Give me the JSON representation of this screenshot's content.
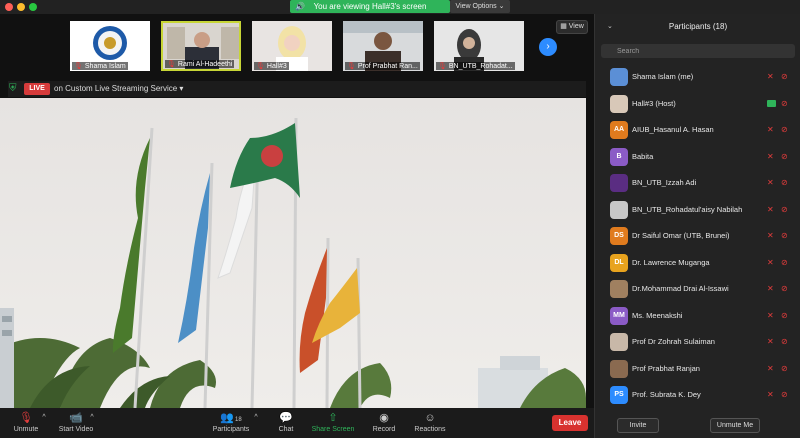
{
  "banner": {
    "viewing_text": "You are viewing Hall#3's screen",
    "view_options_label": "View Options ⌄"
  },
  "thumbnails": [
    {
      "name": "Shama Islam"
    },
    {
      "name": "Rami Al-Hadeethi"
    },
    {
      "name": "Hall#3"
    },
    {
      "name": "Prof Prabhat Ran..."
    },
    {
      "name": "BN_UTB_Rohadat..."
    }
  ],
  "view_button_label": "View",
  "live": {
    "badge": "LIVE",
    "text": "on Custom Live Streaming Service ▾"
  },
  "toolbar": {
    "unmute": "Unmute",
    "start_video": "Start Video",
    "participants": "Participants",
    "participants_count": "18",
    "chat": "Chat",
    "share_screen": "Share Screen",
    "record": "Record",
    "reactions": "Reactions",
    "leave": "Leave"
  },
  "panel": {
    "title": "Participants (18)",
    "search_placeholder": "Search",
    "invite": "Invite",
    "unmute_me": "Unmute Me",
    "participants": [
      {
        "name": "Shama Islam (me)",
        "initials": "",
        "color": "#5b8fd6",
        "status": "muted"
      },
      {
        "name": "Hall#3 (Host)",
        "initials": "",
        "color": "#d8c8b8",
        "status": "sharing"
      },
      {
        "name": "AIUB_Hasanul A. Hasan",
        "initials": "AA",
        "color": "#e07b1e",
        "status": "muted"
      },
      {
        "name": "Babita",
        "initials": "B",
        "color": "#8b5bc6",
        "status": "muted"
      },
      {
        "name": "BN_UTB_Izzah Adi",
        "initials": "",
        "color": "#5a2d82",
        "status": "muted"
      },
      {
        "name": "BN_UTB_Rohadatul'aisy Nabilah",
        "initials": "",
        "color": "#c8c8c8",
        "status": "muted"
      },
      {
        "name": "Dr Saiful Omar (UTB, Brunei)",
        "initials": "DS",
        "color": "#e07b1e",
        "status": "muted"
      },
      {
        "name": "Dr. Lawrence Muganga",
        "initials": "DL",
        "color": "#e8a31e",
        "status": "muted"
      },
      {
        "name": "Dr.Mohammad Drai Al-Issawi",
        "initials": "",
        "color": "#a08060",
        "status": "muted"
      },
      {
        "name": "Ms. Meenakshi",
        "initials": "MM",
        "color": "#8b5bc6",
        "status": "muted"
      },
      {
        "name": "Prof Dr Zohrah Sulaiman",
        "initials": "",
        "color": "#c8b8a8",
        "status": "muted"
      },
      {
        "name": "Prof Prabhat Ranjan",
        "initials": "",
        "color": "#8a6a50",
        "status": "muted"
      },
      {
        "name": "Prof. Subrata K. Dey",
        "initials": "PS",
        "color": "#2d8cff",
        "status": "muted"
      }
    ]
  },
  "colors": {
    "accent_green": "#2fb45a",
    "accent_blue": "#2d8cff",
    "leave_red": "#d8322f",
    "muted_red": "#e23c3c"
  }
}
